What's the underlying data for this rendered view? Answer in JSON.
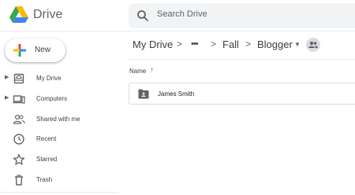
{
  "app": {
    "name": "Drive"
  },
  "search": {
    "placeholder": "Search Drive"
  },
  "new_button": {
    "label": "New"
  },
  "sidebar": {
    "items": [
      {
        "label": "My Drive",
        "icon": "drive-icon"
      },
      {
        "label": "Computers",
        "icon": "computer-icon"
      },
      {
        "label": "Shared with me",
        "icon": "people-icon"
      },
      {
        "label": "Recent",
        "icon": "clock-icon"
      },
      {
        "label": "Starred",
        "icon": "star-icon"
      },
      {
        "label": "Trash",
        "icon": "trash-icon"
      }
    ]
  },
  "breadcrumb": {
    "items": [
      "My Drive",
      "•••",
      "Fall",
      "Blogger"
    ],
    "separator": ">"
  },
  "list": {
    "name_header": "Name",
    "sort_arrow": "↑"
  },
  "folders": [
    {
      "name": "James Smith"
    }
  ],
  "colors": {
    "accent_blue": "#4285f4",
    "accent_green": "#34a853",
    "accent_yellow": "#fbbc04",
    "accent_red": "#ea4335",
    "icon_gray": "#5f6368"
  }
}
